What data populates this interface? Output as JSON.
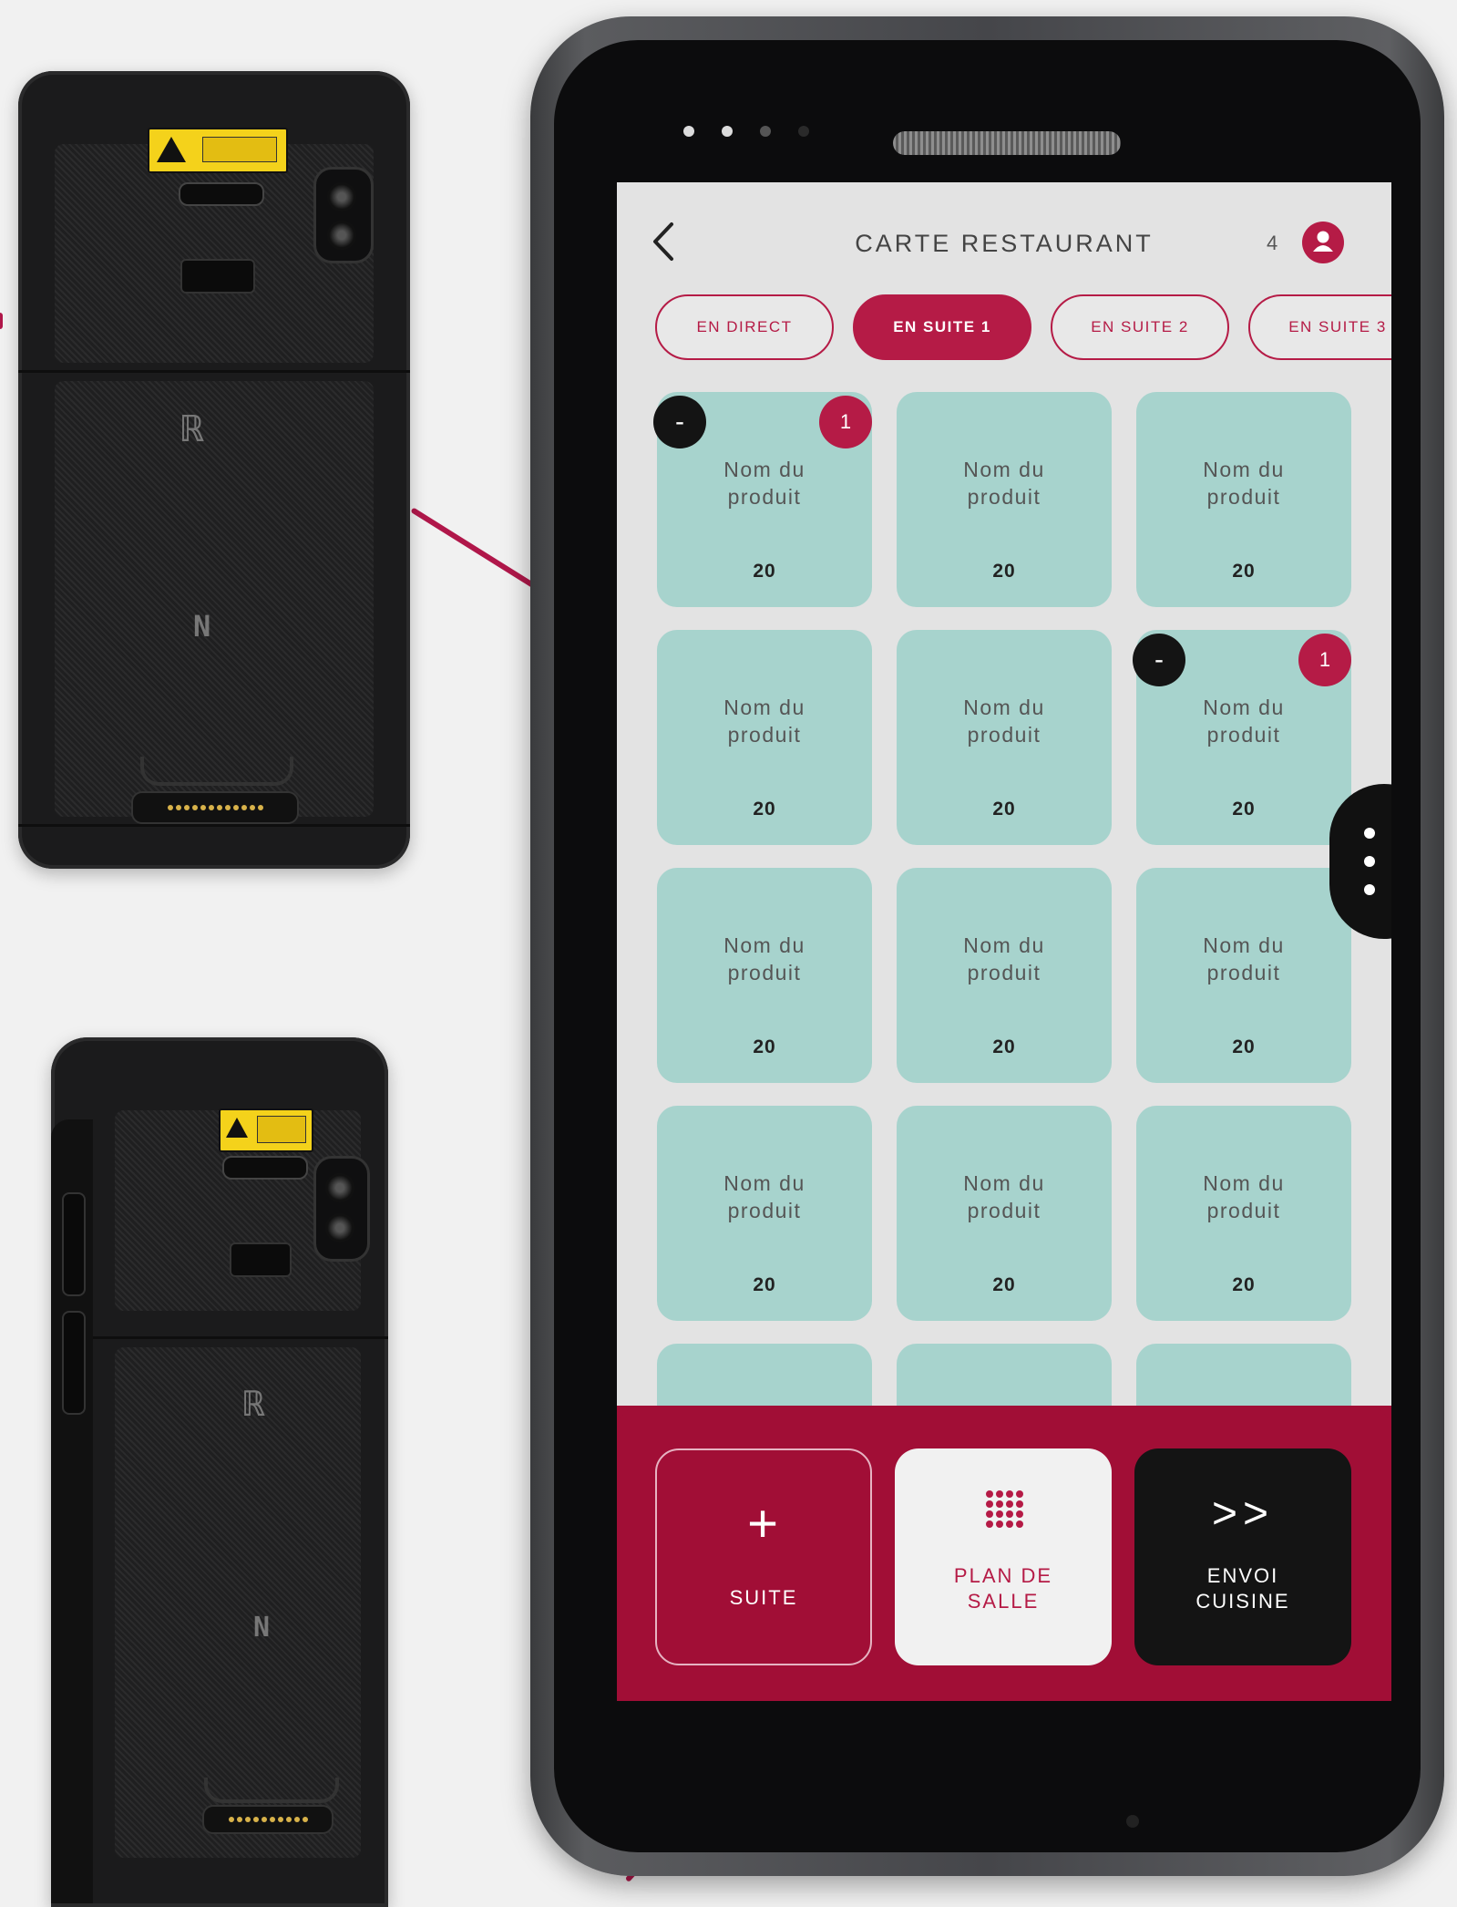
{
  "app": {
    "title": "CARTE RESTAURANT",
    "guest_count": "4",
    "user_icon": "user-icon"
  },
  "tabs": [
    {
      "label": "EN DIRECT",
      "active": false
    },
    {
      "label": "EN SUITE 1",
      "active": true
    },
    {
      "label": "EN SUITE 2",
      "active": false
    },
    {
      "label": "EN SUITE 3",
      "active": false
    }
  ],
  "products": {
    "name_line1": "Nom du",
    "name_line2": "produit",
    "price": "20",
    "minus_label": "-",
    "selected_count": "1"
  },
  "actions": {
    "suite": {
      "icon_glyph": "+",
      "label": "SUITE"
    },
    "plan": {
      "label_line1": "PLAN DE",
      "label_line2": "SALLE"
    },
    "envoi": {
      "icon_glyph": ">>",
      "label_line1": "ENVOI",
      "label_line2": "CUISINE"
    }
  },
  "colors": {
    "brand": "#b51b46",
    "panel": "#a10e36",
    "card": "#a7d3cd",
    "dark": "#141414"
  }
}
